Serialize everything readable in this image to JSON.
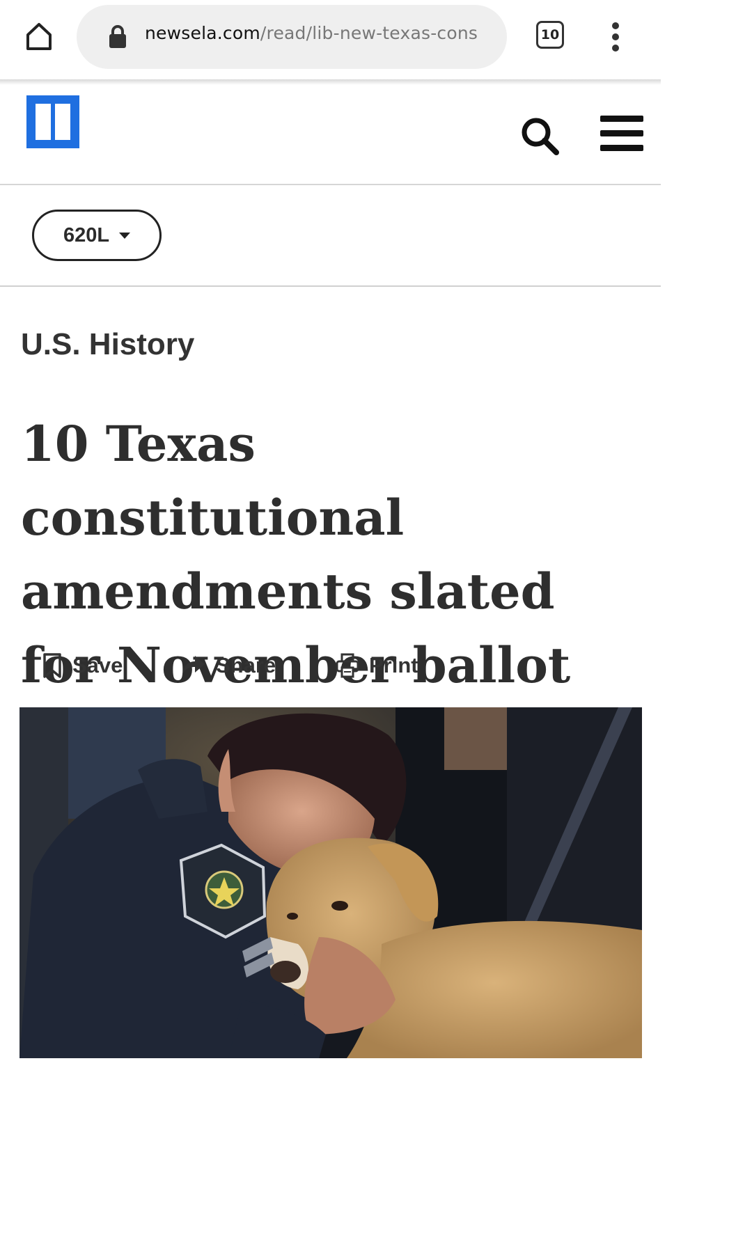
{
  "browser": {
    "url_host": "newsela.com",
    "url_path": "/read/lib-new-texas-cons",
    "tab_count": "10",
    "icons": {
      "home": "home-icon",
      "lock": "lock-icon",
      "menu": "more-vert-icon"
    }
  },
  "site": {
    "logo": "newsela-logo",
    "brand_color": "#1f6fe0",
    "icons": {
      "search": "search-icon",
      "menu": "hamburger-menu-icon"
    }
  },
  "reading_level": {
    "selected": "620L"
  },
  "article": {
    "category": "U.S. History",
    "title": "10 Texas constitutional amendments slated for November ballot",
    "actions": {
      "save": "Save",
      "share": "Share",
      "print": "Print"
    }
  }
}
